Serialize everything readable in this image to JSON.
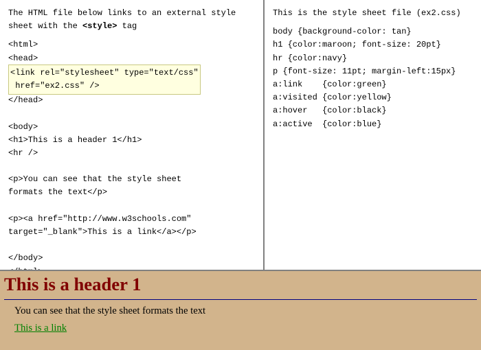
{
  "left": {
    "desc_pre": "The HTML file below links to an external style\nsheet with the ",
    "desc_bold": "<style>",
    "desc_post": " tag",
    "code_before": "<html>\n<head>",
    "code_hl": "<link rel=\"stylesheet\" type=\"text/css\"\n href=\"ex2.css\" />",
    "code_after": "</head>\n\n<body>\n<h1>This is a header 1</h1>\n<hr />\n\n<p>You can see that the style sheet\nformats the text</p>\n\n<p><a href=\"http://www.w3schools.com\"\ntarget=\"_blank\">This is a link</a></p>\n\n</body>\n</html>"
  },
  "right": {
    "desc": "This is the style sheet file (ex2.css)",
    "code": "body {background-color: tan}\nh1 {color:maroon; font-size: 20pt}\nhr {color:navy}\np {font-size: 11pt; margin-left:15px}\na:link    {color:green}\na:visited {color:yellow}\na:hover   {color:black}\na:active  {color:blue}"
  },
  "preview": {
    "h1": "This is a header 1",
    "p1": "You can see that the style sheet formats the text",
    "link": "This is a link"
  }
}
